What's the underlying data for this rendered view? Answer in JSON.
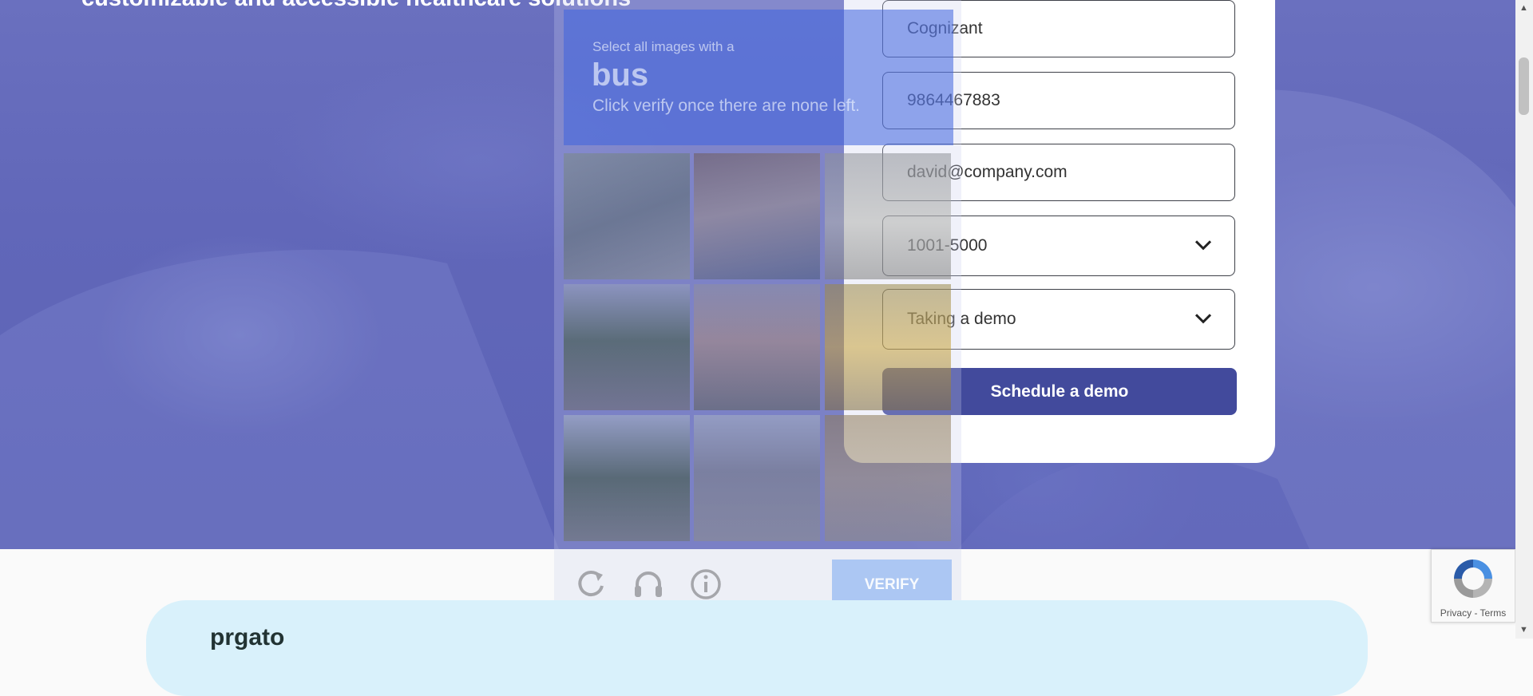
{
  "hero": {
    "title": "customizable and accessible healthcare solutions"
  },
  "form": {
    "company": "Cognizant",
    "phone": "9864467883",
    "email": "david@company.com",
    "company_size": "1001-5000",
    "interest": "Taking a demo",
    "submit_label": "Schedule a demo"
  },
  "captcha": {
    "instruction": "Select all images with a",
    "target": "bus",
    "hint": "Click verify once there are none left.",
    "verify_label": "VERIFY",
    "icons": [
      "reload-icon",
      "audio-icon",
      "info-icon"
    ]
  },
  "bottom": {
    "logo_text": "prgato"
  },
  "recaptcha": {
    "terms": "Privacy - Terms"
  },
  "colors": {
    "hero_overlay": "#6167b9",
    "button": "#424a9c",
    "captcha_header": "#3e62de"
  }
}
